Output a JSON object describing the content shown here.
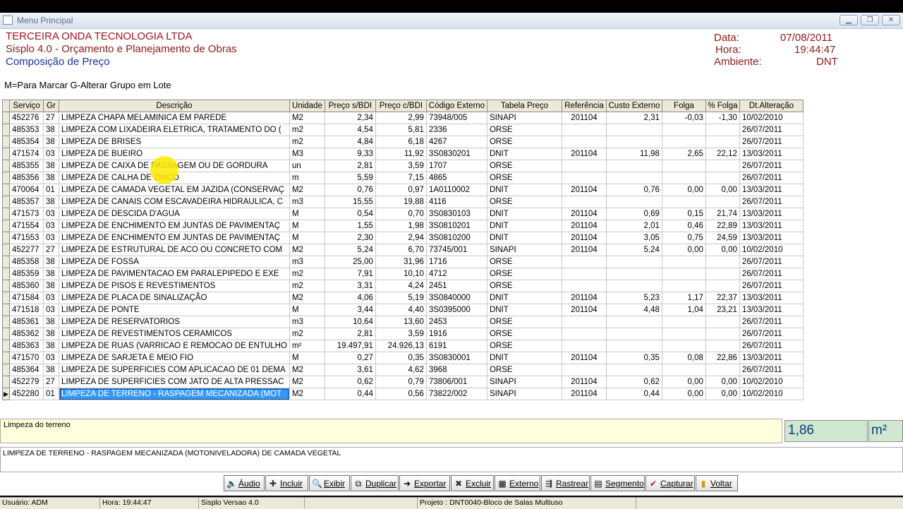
{
  "window": {
    "title": "Menu Principal"
  },
  "header": {
    "company": "TERCEIRA ONDA TECNOLOGIA LTDA",
    "app": "Sisplo 4.0 - Orçamento e Planejamento de Obras",
    "screen": "Composição de Preço",
    "date_label": "Data:",
    "date_value": "07/08/2011",
    "time_label": "Hora:",
    "time_value": "19:44:47",
    "env_label": "Ambiente:",
    "env_value": "DNT"
  },
  "hint": "M=Para Marcar G-Alterar Grupo em Lote",
  "grid": {
    "columns": [
      "Serviço",
      "Gr",
      "Descrição",
      "Unidade",
      "Preço s/BDI",
      "Preço c/BDI",
      "Código Externo",
      "Tabela Preço",
      "Referência",
      "Custo Externo",
      "Folga",
      "% Folga",
      "Dt.Alteração"
    ],
    "rows": [
      [
        "452276",
        "27",
        "LIMPEZA CHAPA MELAMINICA EM PAREDE",
        "M2",
        "2,34",
        "2,99",
        "73948/005",
        "SINAPI",
        "201104",
        "2,31",
        "-0,03",
        "-1,30",
        "10/02/2010"
      ],
      [
        "485353",
        "38",
        "LIMPEZA COM LIXADEIRA ELETRICA, TRATAMENTO DO (",
        "m2",
        "4,54",
        "5,81",
        "2336",
        "ORSE",
        "",
        "",
        "",
        "",
        "26/07/2011"
      ],
      [
        "485354",
        "38",
        "LIMPEZA DE BRISES",
        "m2",
        "4,84",
        "6,18",
        "4267",
        "ORSE",
        "",
        "",
        "",
        "",
        "26/07/2011"
      ],
      [
        "471574",
        "03",
        "LIMPEZA DE BUEIRO",
        "M3",
        "9,33",
        "11,92",
        "3S0830201",
        "DNIT",
        "201104",
        "11,98",
        "2,65",
        "22,12",
        "13/03/2011"
      ],
      [
        "485355",
        "38",
        "LIMPEZA DE CAIXA DE PASSAGEM OU DE GORDURA",
        "un",
        "2,81",
        "3,59",
        "1707",
        "ORSE",
        "",
        "",
        "",
        "",
        "26/07/2011"
      ],
      [
        "485356",
        "38",
        "LIMPEZA DE CALHA DE ZINCO",
        "m",
        "5,59",
        "7,15",
        "4865",
        "ORSE",
        "",
        "",
        "",
        "",
        "26/07/2011"
      ],
      [
        "470064",
        "01",
        "LIMPEZA DE CAMADA VEGETAL EM JAZIDA (CONSERVAÇ",
        "M2",
        "0,76",
        "0,97",
        "1A0110002",
        "DNIT",
        "201104",
        "0,76",
        "0,00",
        "0,00",
        "13/03/2011"
      ],
      [
        "485357",
        "38",
        "LIMPEZA DE CANAIS COM ESCAVADEIRA HIDRAULICA, C",
        "m3",
        "15,55",
        "19,88",
        "4116",
        "ORSE",
        "",
        "",
        "",
        "",
        "26/07/2011"
      ],
      [
        "471573",
        "03",
        "LIMPEZA DE DESCIDA D'AGUA",
        "M",
        "0,54",
        "0,70",
        "3S0830103",
        "DNIT",
        "201104",
        "0,69",
        "0,15",
        "21,74",
        "13/03/2011"
      ],
      [
        "471554",
        "03",
        "LIMPEZA DE ENCHIMENTO EM JUNTAS DE PAVIMENTAÇ",
        "M",
        "1,55",
        "1,98",
        "3S0810201",
        "DNIT",
        "201104",
        "2,01",
        "0,46",
        "22,89",
        "13/03/2011"
      ],
      [
        "471553",
        "03",
        "LIMPEZA DE ENCHIMENTO EM JUNTAS DE PAVIMENTAÇ",
        "M",
        "2,30",
        "2,94",
        "3S0810200",
        "DNIT",
        "201104",
        "3,05",
        "0,75",
        "24,59",
        "13/03/2011"
      ],
      [
        "452277",
        "27",
        "LIMPEZA DE ESTRUTURAL DE ACO OU CONCRETO COM",
        "M2",
        "5,24",
        "6,70",
        "73745/001",
        "SINAPI",
        "201104",
        "5,24",
        "0,00",
        "0,00",
        "10/02/2010"
      ],
      [
        "485358",
        "38",
        "LIMPEZA DE FOSSA",
        "m3",
        "25,00",
        "31,96",
        "1716",
        "ORSE",
        "",
        "",
        "",
        "",
        "26/07/2011"
      ],
      [
        "485359",
        "38",
        "LIMPEZA DE PAVIMENTACAO EM  PARALEPIPEDO E EXE",
        "m2",
        "7,91",
        "10,10",
        "4712",
        "ORSE",
        "",
        "",
        "",
        "",
        "26/07/2011"
      ],
      [
        "485360",
        "38",
        "LIMPEZA DE PISOS E REVESTIMENTOS",
        "m2",
        "3,31",
        "4,24",
        "2451",
        "ORSE",
        "",
        "",
        "",
        "",
        "26/07/2011"
      ],
      [
        "471584",
        "03",
        "LIMPEZA DE PLACA DE SINALIZAÇÃO",
        "M2",
        "4,06",
        "5,19",
        "3S0840000",
        "DNIT",
        "201104",
        "5,23",
        "1,17",
        "22,37",
        "13/03/2011"
      ],
      [
        "471518",
        "03",
        "LIMPEZA DE PONTE",
        "M",
        "3,44",
        "4,40",
        "3S0395000",
        "DNIT",
        "201104",
        "4,48",
        "1,04",
        "23,21",
        "13/03/2011"
      ],
      [
        "485361",
        "38",
        "LIMPEZA DE RESERVATORIOS",
        "m3",
        "10,64",
        "13,60",
        "2453",
        "ORSE",
        "",
        "",
        "",
        "",
        "26/07/2011"
      ],
      [
        "485362",
        "38",
        "LIMPEZA DE REVESTIMENTOS CERAMICOS",
        "m2",
        "2,81",
        "3,59",
        "1916",
        "ORSE",
        "",
        "",
        "",
        "",
        "26/07/2011"
      ],
      [
        "485363",
        "38",
        "LIMPEZA DE RUAS (VARRICAO E REMOCAO DE ENTULHO",
        "m²",
        "19.497,91",
        "24.926,13",
        "6191",
        "ORSE",
        "",
        "",
        "",
        "",
        "26/07/2011"
      ],
      [
        "471570",
        "03",
        "LIMPEZA DE SARJETA E MEIO FIO",
        "M",
        "0,27",
        "0,35",
        "3S0830001",
        "DNIT",
        "201104",
        "0,35",
        "0,08",
        "22,86",
        "13/03/2011"
      ],
      [
        "485364",
        "38",
        "LIMPEZA DE SUPERFICIES COM APLICACAO DE 01 DEMA",
        "M2",
        "3,61",
        "4,62",
        "3968",
        "ORSE",
        "",
        "",
        "",
        "",
        "26/07/2011"
      ],
      [
        "452279",
        "27",
        "LIMPEZA DE SUPERFICIES COM JATO DE ALTA PRESSAC",
        "M2",
        "0,62",
        "0,79",
        "73806/001",
        "SINAPI",
        "201104",
        "0,62",
        "0,00",
        "0,00",
        "10/02/2010"
      ],
      [
        "452280",
        "01",
        "LIMPEZA DE TERRENO - RASPAGEM MECANIZADA (MOT",
        "M2",
        "0,44",
        "0,56",
        "73822/002",
        "SINAPI",
        "201104",
        "0,44",
        "0,00",
        "0,00",
        "10/02/2010"
      ]
    ],
    "selected_index": 23
  },
  "detail": {
    "short_desc": "Limpeza do terreno",
    "quantity": "1,86",
    "unit": "m²",
    "full_desc": "LIMPEZA DE TERRENO - RASPAGEM MECANIZADA (MOTONIVELADORA) DE CAMADA VEGETAL"
  },
  "toolbar": [
    {
      "key": "audio",
      "label": "Áudio",
      "icon": "speaker-icon"
    },
    {
      "key": "incluir",
      "label": "Incluir",
      "icon": "add-icon"
    },
    {
      "key": "exibir",
      "label": "Exibir",
      "icon": "magnifier-icon"
    },
    {
      "key": "duplicar",
      "label": "Duplicar",
      "icon": "duplicate-icon"
    },
    {
      "key": "exportar",
      "label": "Exportar",
      "icon": "export-icon"
    },
    {
      "key": "excluir",
      "label": "Excluir",
      "icon": "delete-icon"
    },
    {
      "key": "externo",
      "label": "Externo",
      "icon": "grid-icon"
    },
    {
      "key": "rastrear",
      "label": "Rastrear",
      "icon": "trace-icon"
    },
    {
      "key": "segmento",
      "label": "Segmento",
      "icon": "segment-icon"
    },
    {
      "key": "capturar",
      "label": "Capturar",
      "icon": "checkmark-icon"
    },
    {
      "key": "voltar",
      "label": "Voltar",
      "icon": "door-icon"
    }
  ],
  "status": {
    "user": "Usuário: ADM",
    "time": "Hora: 19:44:47",
    "version": "Sisplo Versao 4.0",
    "blank": "",
    "project": "Projeto : DNT0040-Bloco de Salas Multiuso"
  },
  "colors": {
    "company": "#a0141e",
    "app": "#8b1a1a",
    "screen": "#1a2f9e",
    "selection": "#3399ff"
  }
}
